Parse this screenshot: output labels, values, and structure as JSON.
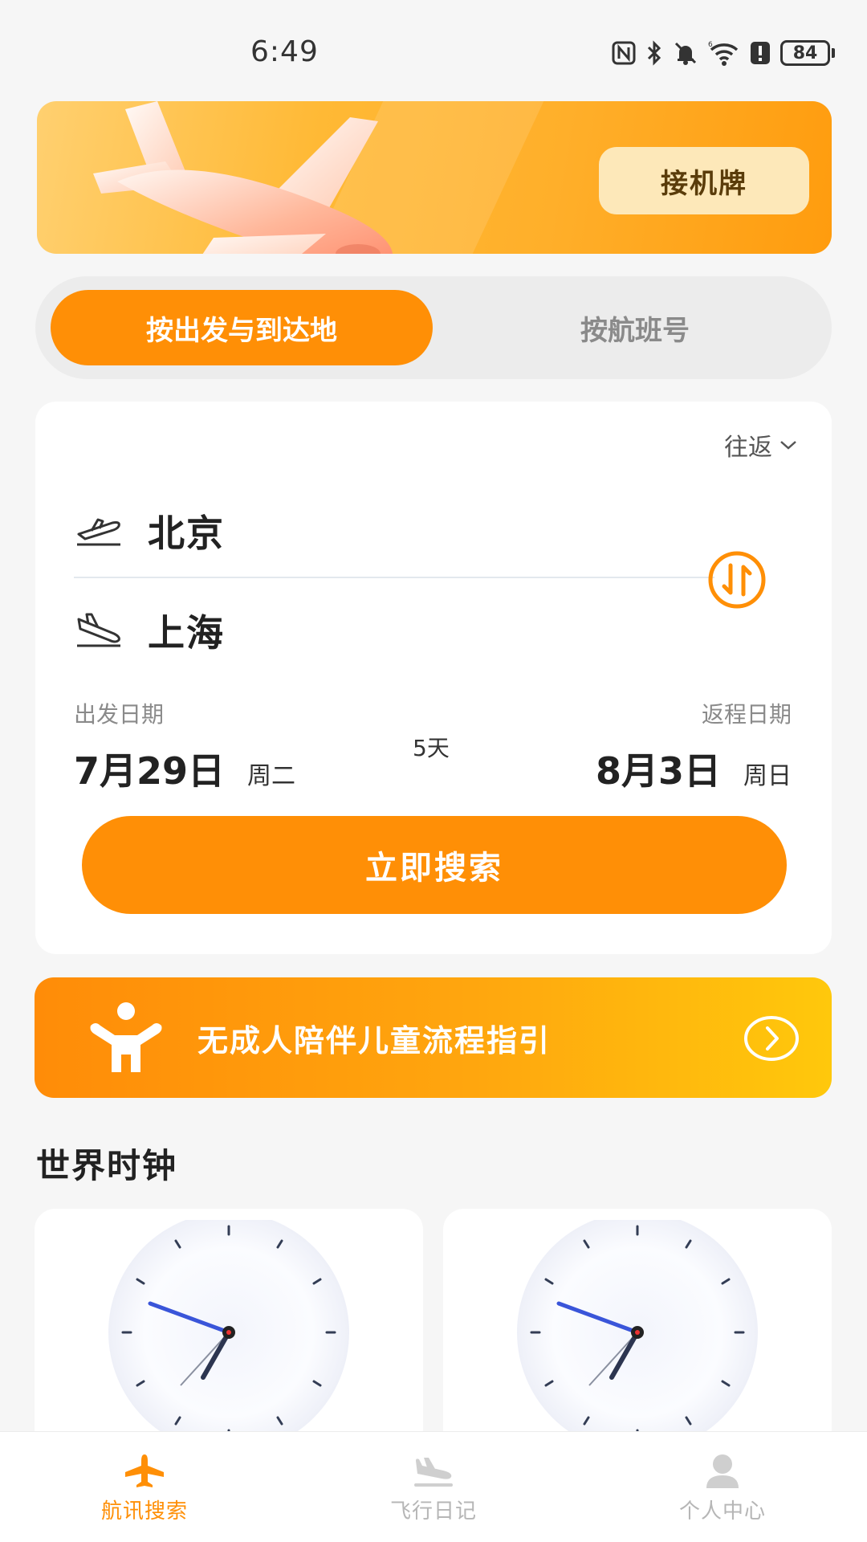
{
  "status_bar": {
    "time": "6:49",
    "battery": "84"
  },
  "banner": {
    "pickup_label": "接机牌"
  },
  "mode_tabs": [
    {
      "label": "按出发与到达地",
      "active": true
    },
    {
      "label": "按航班号",
      "active": false
    }
  ],
  "search": {
    "trip_type": "往返",
    "departure_city": "北京",
    "arrival_city": "上海",
    "departure_date_label": "出发日期",
    "return_date_label": "返程日期",
    "departure_date": "7月29日",
    "departure_weekday": "周二",
    "return_date": "8月3日",
    "return_weekday": "周日",
    "days": "5天",
    "search_button": "立即搜索"
  },
  "guide": {
    "label": "无成人陪伴儿童流程指引"
  },
  "world_clock": {
    "title": "世界时钟"
  },
  "nav": [
    {
      "label": "航讯搜索",
      "icon": "plane-icon",
      "active": true
    },
    {
      "label": "飞行日记",
      "icon": "plane-landing-icon",
      "active": false
    },
    {
      "label": "个人中心",
      "icon": "person-icon",
      "active": false
    }
  ],
  "colors": {
    "accent": "#ff8f06",
    "accent_light": "#fde8b9"
  }
}
